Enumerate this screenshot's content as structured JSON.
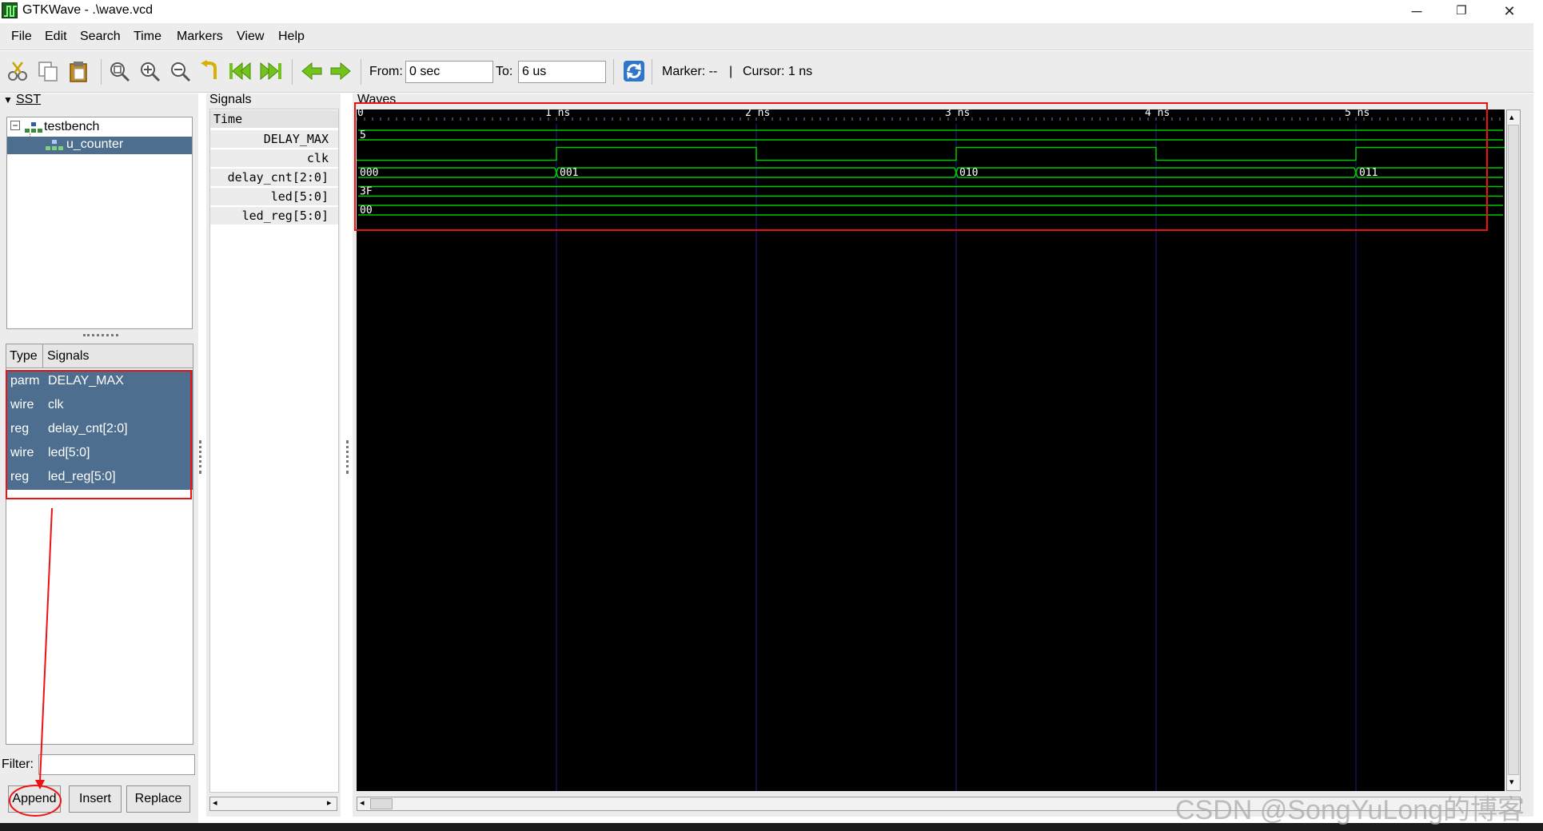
{
  "window": {
    "title": "GTKWave - .\\wave.vcd",
    "controls": {
      "minimize": "─",
      "restore": "❐",
      "close": "✕"
    }
  },
  "menu": [
    "File",
    "Edit",
    "Search",
    "Time",
    "Markers",
    "View",
    "Help"
  ],
  "toolbar": {
    "icons": [
      "cut-icon",
      "copy-icon",
      "paste-icon",
      "zoom-fit-icon",
      "zoom-in-icon",
      "zoom-out-icon",
      "undo-zoom-icon",
      "zoom-start-icon",
      "zoom-end-icon",
      "prev-edge-icon",
      "next-edge-icon",
      "reload-icon"
    ],
    "from_label": "From:",
    "from_value": "0 sec",
    "to_label": "To:",
    "to_value": "6 us",
    "marker_text": "Marker: --",
    "separator": "|",
    "cursor_text": "Cursor: 1 ns"
  },
  "sst": {
    "label": "SST",
    "tree": [
      {
        "name": "testbench",
        "expanded": true
      },
      {
        "name": "u_counter",
        "selected": true
      }
    ],
    "signal_table": {
      "headers": [
        "Type",
        "Signals"
      ],
      "rows": [
        {
          "type": "parm",
          "name": "DELAY_MAX"
        },
        {
          "type": "wire",
          "name": "clk"
        },
        {
          "type": "reg",
          "name": "delay_cnt[2:0]"
        },
        {
          "type": "wire",
          "name": "led[5:0]"
        },
        {
          "type": "reg",
          "name": "led_reg[5:0]"
        }
      ]
    },
    "filter_label": "Filter:",
    "filter_value": "",
    "buttons": {
      "append": "Append",
      "insert": "Insert",
      "replace": "Replace"
    }
  },
  "signals_panel": {
    "label": "Signals",
    "time_label": "Time",
    "names": [
      "DELAY_MAX",
      "clk",
      "delay_cnt[2:0]",
      "led[5:0]",
      "led_reg[5:0]"
    ]
  },
  "waves_panel": {
    "label": "Waves",
    "time_ticks": [
      "0",
      "1 ns",
      "2 ns",
      "3 ns",
      "4 ns",
      "5 ns"
    ],
    "rows": {
      "delay_max": [
        "5"
      ],
      "delay_cnt": [
        "000",
        "001",
        "010",
        "011"
      ],
      "led": [
        "3F"
      ],
      "led_reg": [
        "00"
      ]
    },
    "colors": {
      "background": "#000000",
      "trace": "#00c800",
      "grid": "#1f1f8a",
      "ruler": "#ffffff"
    }
  },
  "watermark": "CSDN @SongYuLong的博客",
  "annotation_color": "#e11111"
}
